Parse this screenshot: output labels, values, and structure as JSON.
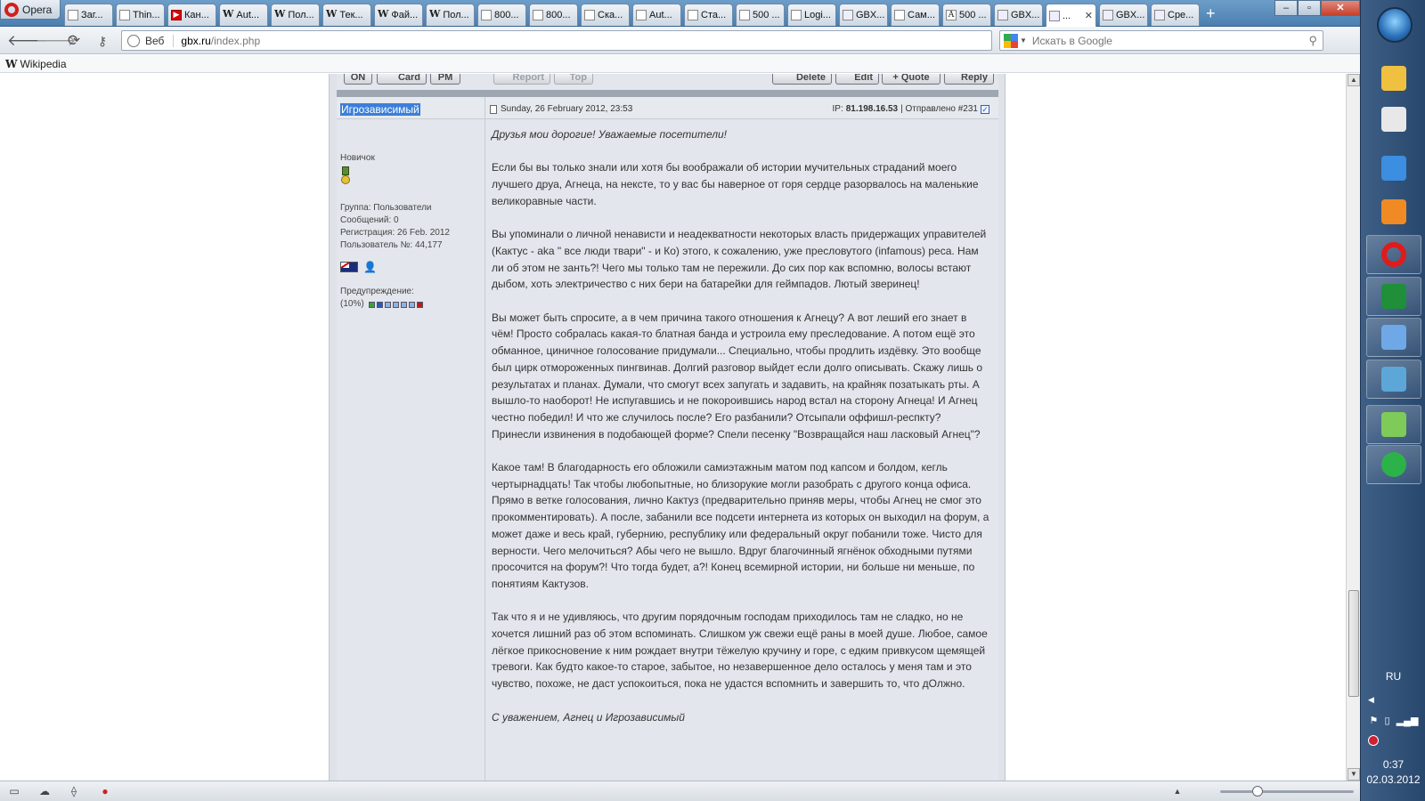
{
  "browser": {
    "menu_label": "Opera",
    "tabs": [
      {
        "label": "Заг...",
        "icon": "page-icon",
        "fav": ""
      },
      {
        "label": "Thin...",
        "icon": "page-icon",
        "fav": ""
      },
      {
        "label": "Кан...",
        "icon": "youtube-icon",
        "fav": "▶"
      },
      {
        "label": "Aut...",
        "icon": "wikipedia-icon",
        "fav": "W"
      },
      {
        "label": "Пол...",
        "icon": "wikipedia-icon",
        "fav": "W"
      },
      {
        "label": "Тек...",
        "icon": "wikipedia-icon",
        "fav": "W"
      },
      {
        "label": "Фай...",
        "icon": "wikipedia-icon",
        "fav": "W"
      },
      {
        "label": "Пол...",
        "icon": "wikipedia-icon",
        "fav": "W"
      },
      {
        "label": "800...",
        "icon": "page-icon",
        "fav": ""
      },
      {
        "label": "800...",
        "icon": "page-icon",
        "fav": ""
      },
      {
        "label": "Cка...",
        "icon": "page-icon",
        "fav": ""
      },
      {
        "label": "Aut...",
        "icon": "page-icon",
        "fav": ""
      },
      {
        "label": "Ста...",
        "icon": "page-icon",
        "fav": ""
      },
      {
        "label": "500 ...",
        "icon": "page-icon",
        "fav": ""
      },
      {
        "label": "Logi...",
        "icon": "page-icon",
        "fav": ""
      },
      {
        "label": "GBX...",
        "icon": "document-icon",
        "fav": ""
      },
      {
        "label": "Сам...",
        "icon": "page-icon",
        "fav": ""
      },
      {
        "label": "500 ...",
        "icon": "page-icon",
        "fav": "A"
      },
      {
        "label": "GBX...",
        "icon": "document-icon",
        "fav": ""
      },
      {
        "label": "...",
        "icon": "document-icon",
        "fav": "",
        "active": true
      },
      {
        "label": "GBX...",
        "icon": "document-icon",
        "fav": ""
      },
      {
        "label": "Сре...",
        "icon": "document-icon",
        "fav": ""
      }
    ],
    "new_tab_label": "+",
    "address": {
      "zone_label": "Веб",
      "host": "gbx.ru",
      "path": "/index.php"
    },
    "search": {
      "placeholder": "Искать в Google"
    },
    "bookmarks": [
      {
        "label": "Wikipedia",
        "icon": "wikipedia-icon"
      }
    ]
  },
  "post": {
    "buttons_left": [
      "ON",
      "Card",
      "PM"
    ],
    "buttons_mid": [
      "Report",
      "Top"
    ],
    "buttons_right": [
      "Delete",
      "Edit",
      "+ Quote",
      "Reply"
    ],
    "author": "Игрозависимый",
    "date": "Sunday, 26 February 2012, 23:53",
    "ip_label": "IP: ",
    "ip": "81.198.16.53",
    "sent_label": " | Отправлено #231",
    "profile": {
      "rank": "Новичок",
      "group": "Группа: Пользователи",
      "messages": "Сообщений: 0",
      "registered": "Регистрация: 26 Feb. 2012",
      "user_no": "Пользователь №: 44,177",
      "warning_label": "Предупреждение:",
      "warning_value": "(10%)"
    },
    "paragraphs": [
      {
        "text": "Друзья мои дорогие! Уважаемые посетители!",
        "italic": true
      },
      {
        "text": "Если бы вы только знали или хотя бы воображали об истории мучительных страданий моего лучшего друа, Агнеца, на нексте, то у вас бы наверное от горя сердце разорвалось на маленькие великоравные части.",
        "italic": false
      },
      {
        "text": "Вы упоминали о личной ненависти и неадекватности некоторых власть придержащих управителей (Кактус - aka \" все люди твари\" - и Ко) этого, к сожалению, уже пресловутого (infamous) реса. Нам ли об этом не занть?! Чего мы только там не пережили. До сих пор как вспомню, волосы встают дыбом, хоть электричество с них бери на батарейки для геймпадов. Лютый зверинец!",
        "italic": false
      },
      {
        "text": "Вы может быть спросите, а в чем причина такого отношения к Агнецу? А вот леший его знает в чём! Просто собралась какая-то блатная банда и устроила ему преследование. А потом ещё это обманное, циничное голосование придумали... Специально, чтобы продлить издёвку. Это вообще был цирк отмороженных пингвинав. Долгий разговор выйдет если долго описывать. Скажу лишь о результатах и планах. Думали, что смогут всех запугать и задавить, на крайняк позатыкать рты. А вышло-то наоборот! Не испугавшись и не покороившись народ встал на сторону Агнеца! И Агнец честно победил! И что же случилось после? Его разбанили? Отсыпали оффишл-респкту? Принесли извинения в подобающей форме? Спели песенку \"Возвращайся наш ласковый Агнец\"?",
        "italic": false
      },
      {
        "text": "Какое там! В благодарность его обложили самиэтажным матом под капсом и болдом, кегль чертырнадцать! Так чтобы любопытные, но близорукие могли разобрать с другого конца офиса. Прямо в ветке голосования, лично Кактуз (предварительно приняв меры, чтобы Агнец не смог это прокомментировать). А после, забанили все подсети интернета из которых он выходил на форум, а может даже и весь край, губернию, республику или федеральный округ побанили тоже. Чисто для верности. Чего мелочиться? Абы чего не вышло. Вдруг благочинный ягнёнок обходными путями просочится на форум?! Что тогда будет, а?! Конец всемирной истории, ни больше ни меньше, по понятиям Кактузов.",
        "italic": false
      },
      {
        "text": "Так что я и не удивляюсь, что другим порядочным господам приходилось там не сладко, но не хочется лишний раз об этом вспоминать. Слишком уж свежи ещё раны в моей душе. Любое, самое лёгкое прикосновение к ним рождает внутри тёжелую кручину и горе, с едким привкусом щемящей тревоги. Как будто какое-то старое, забытое, но незавершенное дело осталось у меня там и это чувство, похоже, не даст успокоиться, пока не удастся вспомнить и завершить то, что дОлжно.",
        "italic": false
      },
      {
        "text": "С уважением, Агнец и Игрозависимый",
        "italic": true
      }
    ]
  },
  "taskbar": {
    "apps": [
      {
        "name": "explorer",
        "color": "#f0c040"
      },
      {
        "name": "notepad",
        "color": "#e8e8e8"
      },
      {
        "name": "internet-explorer",
        "color": "#3b8ee0"
      },
      {
        "name": "media-player",
        "color": "#f08a24"
      },
      {
        "name": "opera",
        "color": "#e01b1b"
      },
      {
        "name": "excel",
        "color": "#1f8f3a"
      },
      {
        "name": "control-panel",
        "color": "#6fa8e6"
      },
      {
        "name": "picture-viewer",
        "color": "#5da6d8"
      },
      {
        "name": "recycle-app",
        "color": "#7ecb5a"
      },
      {
        "name": "network-app",
        "color": "#2bb34a"
      }
    ],
    "language": "RU",
    "time": "0:37",
    "date": "02.03.2012"
  }
}
